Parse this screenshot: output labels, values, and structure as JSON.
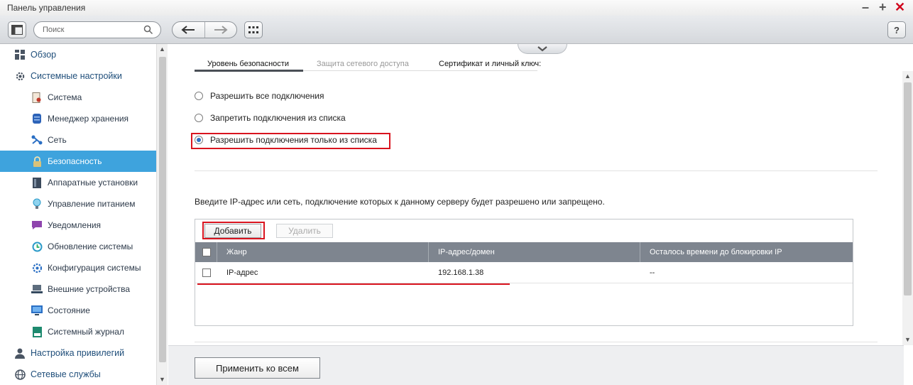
{
  "window": {
    "title": "Панель управления"
  },
  "toolbar": {
    "search_placeholder": "Поиск",
    "help_label": "?"
  },
  "sidebar": {
    "items": [
      {
        "label": "Обзор",
        "icon": "overview-icon"
      },
      {
        "label": "Системные настройки",
        "icon": "gear-icon"
      },
      {
        "label": "Система",
        "icon": "system-icon"
      },
      {
        "label": "Менеджер хранения",
        "icon": "storage-icon"
      },
      {
        "label": "Сеть",
        "icon": "network-icon"
      },
      {
        "label": "Безопасность",
        "icon": "lock-icon",
        "active": true
      },
      {
        "label": "Аппаратные установки",
        "icon": "hardware-icon"
      },
      {
        "label": "Управление питанием",
        "icon": "power-icon"
      },
      {
        "label": "Уведомления",
        "icon": "notification-icon"
      },
      {
        "label": "Обновление системы",
        "icon": "update-icon"
      },
      {
        "label": "Конфигурация системы",
        "icon": "config-icon"
      },
      {
        "label": "Внешние устройства",
        "icon": "external-device-icon"
      },
      {
        "label": "Состояние",
        "icon": "status-icon"
      },
      {
        "label": "Системный журнал",
        "icon": "log-icon"
      },
      {
        "label": "Настройка привилегий",
        "icon": "user-icon"
      },
      {
        "label": "Сетевые службы",
        "icon": "network-services-icon"
      }
    ]
  },
  "tabs": [
    {
      "label": "Уровень безопасности",
      "active": true
    },
    {
      "label": "Защита сетевого доступа",
      "active": false
    },
    {
      "label": "Сертификат и личный ключ:",
      "active": false
    }
  ],
  "options": [
    {
      "label": "Разрешить все подключения",
      "selected": false
    },
    {
      "label": "Запретить подключения из списка",
      "selected": false
    },
    {
      "label": "Разрешить подключения только из списка",
      "selected": true
    }
  ],
  "description": "Введите IP-адрес или сеть, подключение которых к данному серверу будет разрешено или запрещено.",
  "list_toolbar": {
    "add_label": "Добавить",
    "delete_label": "Удалить"
  },
  "table": {
    "columns": [
      "Жанр",
      "IP-адрес/домен",
      "Осталось времени до блокировки IP"
    ],
    "rows": [
      {
        "type": "IP-адрес",
        "address": "192.168.1.38",
        "remaining": "--"
      }
    ]
  },
  "footer": {
    "apply_label": "Применить ко всем"
  },
  "colors": {
    "accent": "#3ea3dd",
    "highlight": "#d9141f",
    "table_header": "#7e858f"
  }
}
